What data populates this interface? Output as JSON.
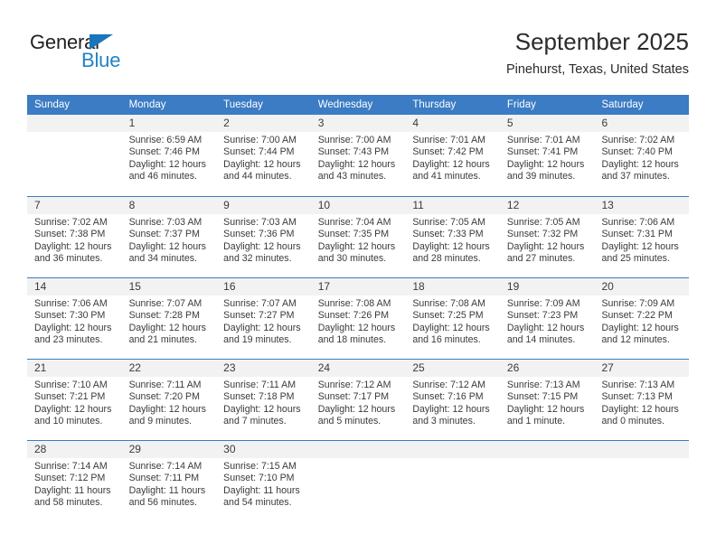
{
  "brand": {
    "name_top": "General",
    "name_bottom": "Blue",
    "triangle_icon": "triangle-icon",
    "color_top": "#231f20",
    "color_bottom": "#2283c6",
    "triangle_color": "#1b75bb"
  },
  "header": {
    "title": "September 2025",
    "subtitle": "Pinehurst, Texas, United States"
  },
  "colors": {
    "header_blue": "#3b7cc4",
    "day_band_gray": "#f2f2f2",
    "text": "#3a3a3a"
  },
  "calendar": {
    "weekdays": [
      "Sunday",
      "Monday",
      "Tuesday",
      "Wednesday",
      "Thursday",
      "Friday",
      "Saturday"
    ],
    "weeks": [
      [
        {
          "day": "",
          "empty": true
        },
        {
          "day": "1",
          "sunrise": "Sunrise: 6:59 AM",
          "sunset": "Sunset: 7:46 PM",
          "daylight_line1": "Daylight: 12 hours",
          "daylight_line2": "and 46 minutes."
        },
        {
          "day": "2",
          "sunrise": "Sunrise: 7:00 AM",
          "sunset": "Sunset: 7:44 PM",
          "daylight_line1": "Daylight: 12 hours",
          "daylight_line2": "and 44 minutes."
        },
        {
          "day": "3",
          "sunrise": "Sunrise: 7:00 AM",
          "sunset": "Sunset: 7:43 PM",
          "daylight_line1": "Daylight: 12 hours",
          "daylight_line2": "and 43 minutes."
        },
        {
          "day": "4",
          "sunrise": "Sunrise: 7:01 AM",
          "sunset": "Sunset: 7:42 PM",
          "daylight_line1": "Daylight: 12 hours",
          "daylight_line2": "and 41 minutes."
        },
        {
          "day": "5",
          "sunrise": "Sunrise: 7:01 AM",
          "sunset": "Sunset: 7:41 PM",
          "daylight_line1": "Daylight: 12 hours",
          "daylight_line2": "and 39 minutes."
        },
        {
          "day": "6",
          "sunrise": "Sunrise: 7:02 AM",
          "sunset": "Sunset: 7:40 PM",
          "daylight_line1": "Daylight: 12 hours",
          "daylight_line2": "and 37 minutes."
        }
      ],
      [
        {
          "day": "7",
          "sunrise": "Sunrise: 7:02 AM",
          "sunset": "Sunset: 7:38 PM",
          "daylight_line1": "Daylight: 12 hours",
          "daylight_line2": "and 36 minutes."
        },
        {
          "day": "8",
          "sunrise": "Sunrise: 7:03 AM",
          "sunset": "Sunset: 7:37 PM",
          "daylight_line1": "Daylight: 12 hours",
          "daylight_line2": "and 34 minutes."
        },
        {
          "day": "9",
          "sunrise": "Sunrise: 7:03 AM",
          "sunset": "Sunset: 7:36 PM",
          "daylight_line1": "Daylight: 12 hours",
          "daylight_line2": "and 32 minutes."
        },
        {
          "day": "10",
          "sunrise": "Sunrise: 7:04 AM",
          "sunset": "Sunset: 7:35 PM",
          "daylight_line1": "Daylight: 12 hours",
          "daylight_line2": "and 30 minutes."
        },
        {
          "day": "11",
          "sunrise": "Sunrise: 7:05 AM",
          "sunset": "Sunset: 7:33 PM",
          "daylight_line1": "Daylight: 12 hours",
          "daylight_line2": "and 28 minutes."
        },
        {
          "day": "12",
          "sunrise": "Sunrise: 7:05 AM",
          "sunset": "Sunset: 7:32 PM",
          "daylight_line1": "Daylight: 12 hours",
          "daylight_line2": "and 27 minutes."
        },
        {
          "day": "13",
          "sunrise": "Sunrise: 7:06 AM",
          "sunset": "Sunset: 7:31 PM",
          "daylight_line1": "Daylight: 12 hours",
          "daylight_line2": "and 25 minutes."
        }
      ],
      [
        {
          "day": "14",
          "sunrise": "Sunrise: 7:06 AM",
          "sunset": "Sunset: 7:30 PM",
          "daylight_line1": "Daylight: 12 hours",
          "daylight_line2": "and 23 minutes."
        },
        {
          "day": "15",
          "sunrise": "Sunrise: 7:07 AM",
          "sunset": "Sunset: 7:28 PM",
          "daylight_line1": "Daylight: 12 hours",
          "daylight_line2": "and 21 minutes."
        },
        {
          "day": "16",
          "sunrise": "Sunrise: 7:07 AM",
          "sunset": "Sunset: 7:27 PM",
          "daylight_line1": "Daylight: 12 hours",
          "daylight_line2": "and 19 minutes."
        },
        {
          "day": "17",
          "sunrise": "Sunrise: 7:08 AM",
          "sunset": "Sunset: 7:26 PM",
          "daylight_line1": "Daylight: 12 hours",
          "daylight_line2": "and 18 minutes."
        },
        {
          "day": "18",
          "sunrise": "Sunrise: 7:08 AM",
          "sunset": "Sunset: 7:25 PM",
          "daylight_line1": "Daylight: 12 hours",
          "daylight_line2": "and 16 minutes."
        },
        {
          "day": "19",
          "sunrise": "Sunrise: 7:09 AM",
          "sunset": "Sunset: 7:23 PM",
          "daylight_line1": "Daylight: 12 hours",
          "daylight_line2": "and 14 minutes."
        },
        {
          "day": "20",
          "sunrise": "Sunrise: 7:09 AM",
          "sunset": "Sunset: 7:22 PM",
          "daylight_line1": "Daylight: 12 hours",
          "daylight_line2": "and 12 minutes."
        }
      ],
      [
        {
          "day": "21",
          "sunrise": "Sunrise: 7:10 AM",
          "sunset": "Sunset: 7:21 PM",
          "daylight_line1": "Daylight: 12 hours",
          "daylight_line2": "and 10 minutes."
        },
        {
          "day": "22",
          "sunrise": "Sunrise: 7:11 AM",
          "sunset": "Sunset: 7:20 PM",
          "daylight_line1": "Daylight: 12 hours",
          "daylight_line2": "and 9 minutes."
        },
        {
          "day": "23",
          "sunrise": "Sunrise: 7:11 AM",
          "sunset": "Sunset: 7:18 PM",
          "daylight_line1": "Daylight: 12 hours",
          "daylight_line2": "and 7 minutes."
        },
        {
          "day": "24",
          "sunrise": "Sunrise: 7:12 AM",
          "sunset": "Sunset: 7:17 PM",
          "daylight_line1": "Daylight: 12 hours",
          "daylight_line2": "and 5 minutes."
        },
        {
          "day": "25",
          "sunrise": "Sunrise: 7:12 AM",
          "sunset": "Sunset: 7:16 PM",
          "daylight_line1": "Daylight: 12 hours",
          "daylight_line2": "and 3 minutes."
        },
        {
          "day": "26",
          "sunrise": "Sunrise: 7:13 AM",
          "sunset": "Sunset: 7:15 PM",
          "daylight_line1": "Daylight: 12 hours",
          "daylight_line2": "and 1 minute."
        },
        {
          "day": "27",
          "sunrise": "Sunrise: 7:13 AM",
          "sunset": "Sunset: 7:13 PM",
          "daylight_line1": "Daylight: 12 hours",
          "daylight_line2": "and 0 minutes."
        }
      ],
      [
        {
          "day": "28",
          "sunrise": "Sunrise: 7:14 AM",
          "sunset": "Sunset: 7:12 PM",
          "daylight_line1": "Daylight: 11 hours",
          "daylight_line2": "and 58 minutes."
        },
        {
          "day": "29",
          "sunrise": "Sunrise: 7:14 AM",
          "sunset": "Sunset: 7:11 PM",
          "daylight_line1": "Daylight: 11 hours",
          "daylight_line2": "and 56 minutes."
        },
        {
          "day": "30",
          "sunrise": "Sunrise: 7:15 AM",
          "sunset": "Sunset: 7:10 PM",
          "daylight_line1": "Daylight: 11 hours",
          "daylight_line2": "and 54 minutes."
        },
        {
          "day": "",
          "empty": true
        },
        {
          "day": "",
          "empty": true
        },
        {
          "day": "",
          "empty": true
        },
        {
          "day": "",
          "empty": true
        }
      ]
    ]
  }
}
